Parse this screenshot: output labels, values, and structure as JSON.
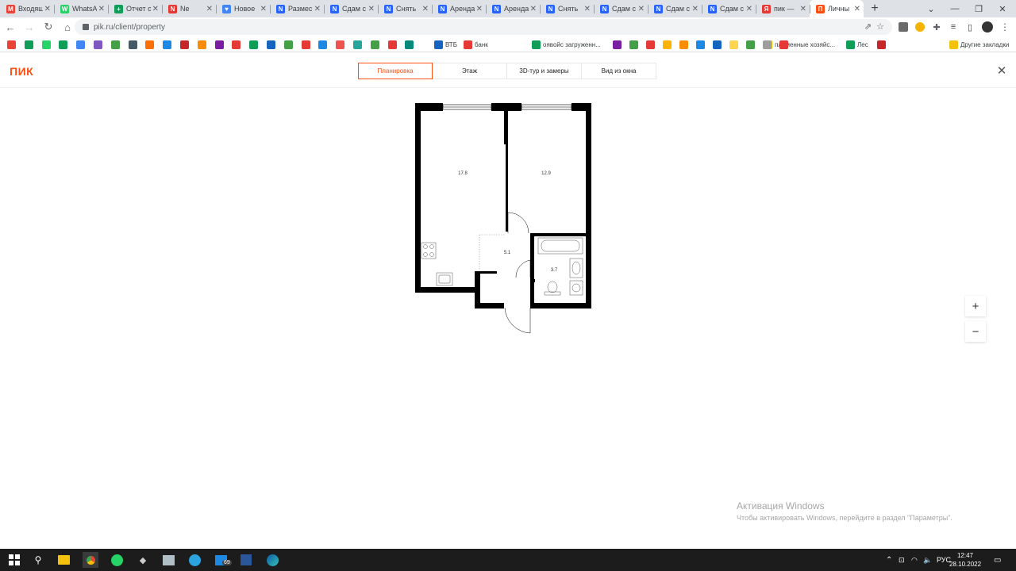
{
  "browser": {
    "tabs": [
      {
        "title": "Входящ",
        "fav_color": "#ea4335",
        "fav_letter": "M"
      },
      {
        "title": "WhatsA",
        "fav_color": "#25d366",
        "fav_letter": "W"
      },
      {
        "title": "Отчет о",
        "fav_color": "#0f9d58",
        "fav_letter": "+"
      },
      {
        "title": "Ne",
        "fav_color": "#e53935",
        "fav_letter": "N"
      },
      {
        "title": "Новое",
        "fav_color": "#4285f4",
        "fav_letter": "♥"
      },
      {
        "title": "Размес",
        "fav_color": "#2962ff",
        "fav_letter": "N"
      },
      {
        "title": "Сдам с",
        "fav_color": "#2962ff",
        "fav_letter": "N"
      },
      {
        "title": "Снять",
        "fav_color": "#2962ff",
        "fav_letter": "N"
      },
      {
        "title": "Аренда",
        "fav_color": "#2962ff",
        "fav_letter": "N"
      },
      {
        "title": "Аренда",
        "fav_color": "#2962ff",
        "fav_letter": "N"
      },
      {
        "title": "Снять",
        "fav_color": "#2962ff",
        "fav_letter": "N"
      },
      {
        "title": "Сдам с",
        "fav_color": "#2962ff",
        "fav_letter": "N"
      },
      {
        "title": "Сдам с",
        "fav_color": "#2962ff",
        "fav_letter": "N"
      },
      {
        "title": "Сдам с",
        "fav_color": "#2962ff",
        "fav_letter": "N"
      },
      {
        "title": "пик —",
        "fav_color": "#e53935",
        "fav_letter": "Я"
      },
      {
        "title": "Личны",
        "fav_color": "#ff4f12",
        "fav_letter": "П",
        "active": true
      }
    ],
    "address": "pik.ru/client/property",
    "bookmarks_named": {
      "vtb": "ВТБ",
      "bank": "банк",
      "oyavoy": "оявойс загруженн...",
      "plem": "племенные хозяйс...",
      "les": "Лес",
      "other": "Другие закладки"
    }
  },
  "app": {
    "logo": "ПИК",
    "tabs": [
      "Планировка",
      "Этаж",
      "3D-тур и замеры",
      "Вид из окна"
    ],
    "active_tab": "Планировка",
    "plan": {
      "rooms": [
        {
          "id": "kitchen-living",
          "area": "17.8"
        },
        {
          "id": "bedroom",
          "area": "12.9"
        },
        {
          "id": "hallway",
          "area": "5.1"
        },
        {
          "id": "bathroom",
          "area": "3.7"
        }
      ]
    },
    "zoom_in": "+",
    "zoom_out": "−"
  },
  "watermark": {
    "line1": "Активация Windows",
    "line2": "Чтобы активировать Windows, перейдите в раздел \"Параметры\"."
  },
  "taskbar": {
    "lang": "РУС",
    "time": "12:47",
    "date": "28.10.2022",
    "telegram_badge": "69"
  },
  "colors": {
    "brand": "#ff4f12",
    "wall": "#000000",
    "taskbar": "#1c1c1c"
  }
}
